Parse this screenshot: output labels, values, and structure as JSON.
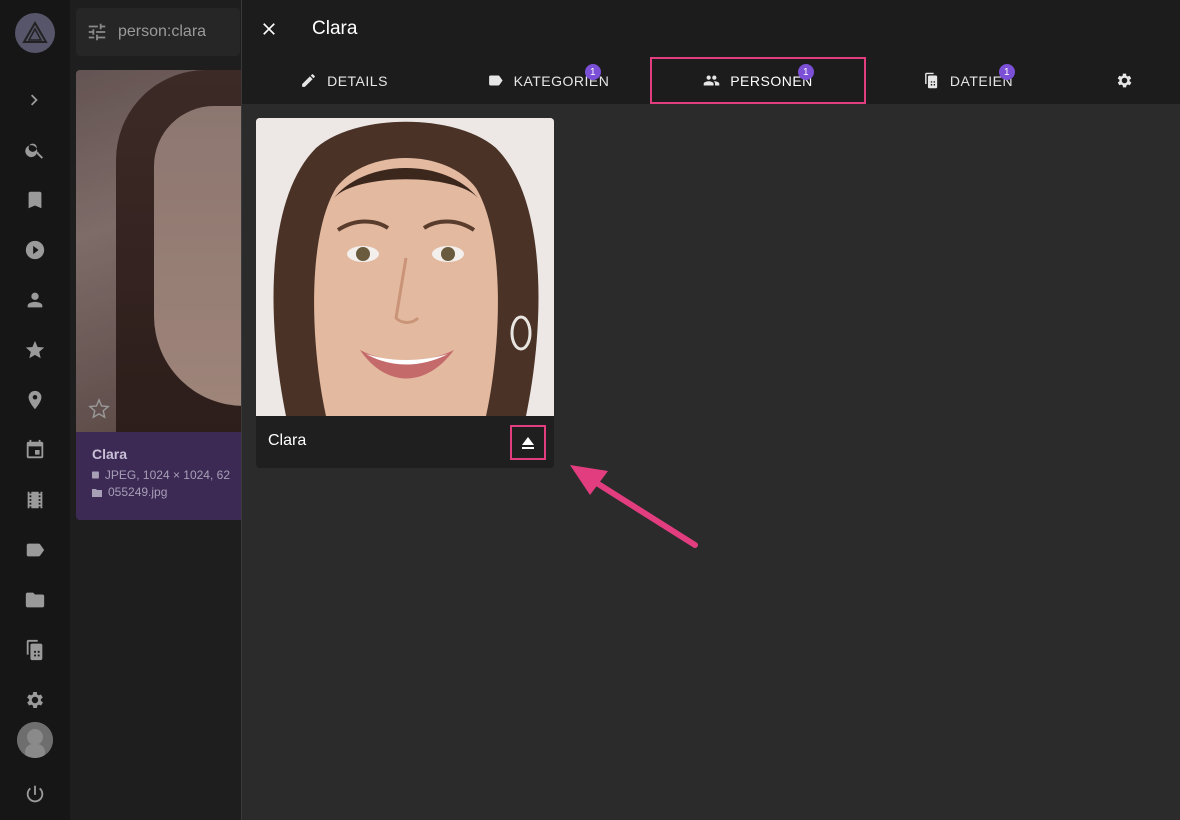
{
  "search": {
    "query": "person:clara"
  },
  "background_card": {
    "title": "Clara",
    "info_line": "JPEG, 1024 × 1024, 62",
    "file_line": "055249.jpg"
  },
  "dialog": {
    "title": "Clara",
    "tabs": [
      {
        "label": "DETAILS",
        "badge": ""
      },
      {
        "label": "KATEGORIEN",
        "badge": "1"
      },
      {
        "label": "PERSONEN",
        "badge": "1"
      },
      {
        "label": "DATEIEN",
        "badge": "1"
      }
    ],
    "active_tab": "PERSONEN",
    "person": {
      "name": "Clara"
    }
  },
  "colors": {
    "accent": "#e13d7f",
    "badge": "#7b4fd6",
    "caption_bg": "#3c2a55"
  },
  "icons": {
    "close": "close-icon",
    "eject": "eject-icon",
    "settings": "gear-icon"
  }
}
